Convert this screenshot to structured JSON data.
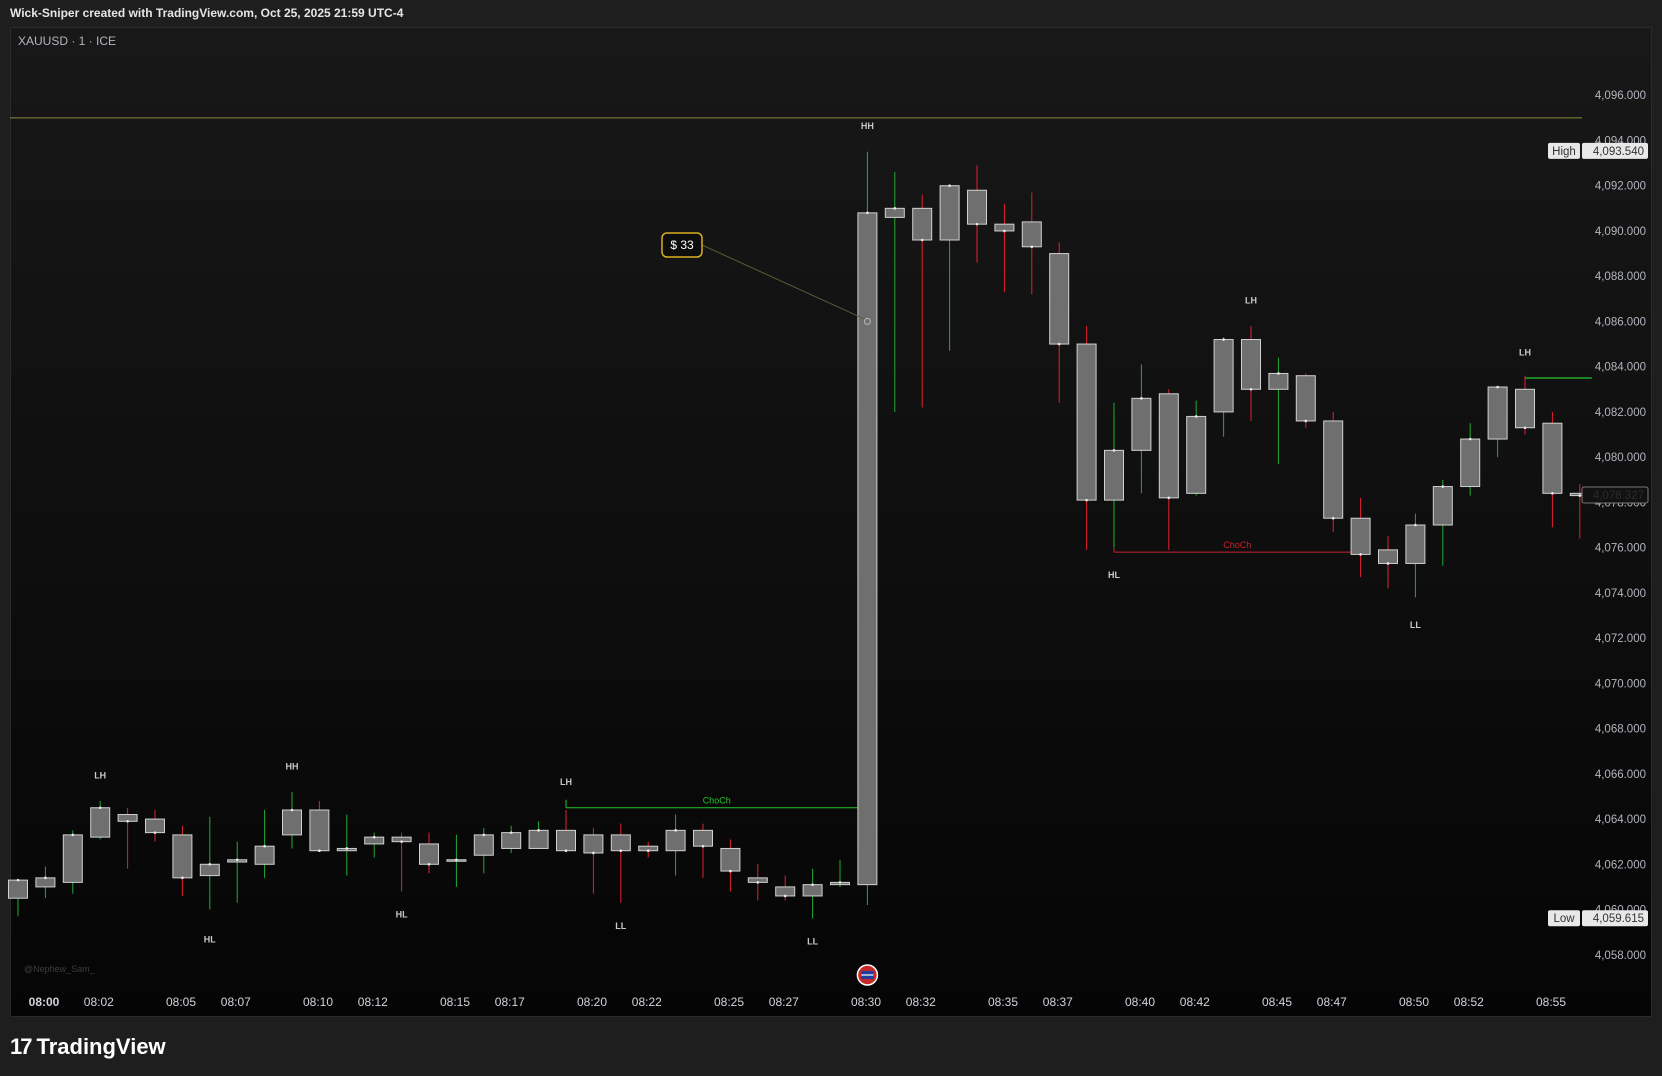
{
  "header": {
    "title": "Wick-Sniper created with TradingView.com, Oct 25, 2025 21:59 UTC-4",
    "symbol": "XAUUSD · 1 · ICE",
    "watermark": "@Nephew_Sam_",
    "brand": "TradingView",
    "brand_logo": "17"
  },
  "colors": {
    "up_wick": "#22ab35",
    "down_wick": "#e0202e",
    "candle_body": "#6f6f6f",
    "candle_border": "#d0d0d0",
    "choch_up": "#24c52b",
    "choch_down": "#c8212d",
    "level_line": "#8a8a3a",
    "callout_border": "#d9b021"
  },
  "chart_data": {
    "type": "candlestick",
    "ylim": [
      4056.0,
      4098.0
    ],
    "yticks": [
      "4,096.000",
      "4,094.000",
      "4,092.000",
      "4,090.000",
      "4,088.000",
      "4,086.000",
      "4,084.000",
      "4,082.000",
      "4,080.000",
      "4,078.000",
      "4,076.000",
      "4,074.000",
      "4,072.000",
      "4,070.000",
      "4,068.000",
      "4,066.000",
      "4,064.000",
      "4,062.000",
      "4,060.000",
      "4,058.000"
    ],
    "ytick_values": [
      4096,
      4094,
      4092,
      4090,
      4088,
      4086,
      4084,
      4082,
      4080,
      4078,
      4076,
      4074,
      4072,
      4070,
      4068,
      4066,
      4064,
      4062,
      4060,
      4058
    ],
    "xticks": [
      {
        "label": "08:00",
        "i": 0,
        "bold": true
      },
      {
        "label": "08:02",
        "i": 2
      },
      {
        "label": "08:05",
        "i": 5
      },
      {
        "label": "08:07",
        "i": 7
      },
      {
        "label": "08:10",
        "i": 10
      },
      {
        "label": "08:12",
        "i": 12
      },
      {
        "label": "08:15",
        "i": 15
      },
      {
        "label": "08:17",
        "i": 17
      },
      {
        "label": "08:20",
        "i": 20
      },
      {
        "label": "08:22",
        "i": 22
      },
      {
        "label": "08:25",
        "i": 25
      },
      {
        "label": "08:27",
        "i": 27
      },
      {
        "label": "08:30",
        "i": 30
      },
      {
        "label": "08:32",
        "i": 32
      },
      {
        "label": "08:35",
        "i": 35
      },
      {
        "label": "08:37",
        "i": 37
      },
      {
        "label": "08:40",
        "i": 40
      },
      {
        "label": "08:42",
        "i": 42
      },
      {
        "label": "08:45",
        "i": 45
      },
      {
        "label": "08:47",
        "i": 47
      },
      {
        "label": "08:50",
        "i": 50
      },
      {
        "label": "08:52",
        "i": 52
      },
      {
        "label": "08:55",
        "i": 55
      }
    ],
    "candles": [
      {
        "t": "08:00",
        "o": 4060.5,
        "h": 4061.2,
        "l": 4059.7,
        "c": 4061.3
      },
      {
        "t": "08:01",
        "o": 4061.0,
        "h": 4061.9,
        "l": 4060.5,
        "c": 4061.4
      },
      {
        "t": "08:02",
        "o": 4061.2,
        "h": 4063.5,
        "l": 4060.7,
        "c": 4063.3
      },
      {
        "t": "08:03",
        "o": 4063.2,
        "h": 4064.8,
        "l": 4063.1,
        "c": 4064.5
      },
      {
        "t": "08:04",
        "o": 4064.2,
        "h": 4064.5,
        "l": 4061.8,
        "c": 4063.9
      },
      {
        "t": "08:05",
        "o": 4064.0,
        "h": 4064.4,
        "l": 4063.0,
        "c": 4063.4
      },
      {
        "t": "08:06",
        "o": 4063.3,
        "h": 4063.7,
        "l": 4060.6,
        "c": 4061.4
      },
      {
        "t": "08:07",
        "o": 4061.5,
        "h": 4064.1,
        "l": 4060.0,
        "c": 4062.0
      },
      {
        "t": "08:08",
        "o": 4062.1,
        "h": 4063.0,
        "l": 4060.3,
        "c": 4062.2
      },
      {
        "t": "08:09",
        "o": 4062.0,
        "h": 4064.4,
        "l": 4061.4,
        "c": 4062.8
      },
      {
        "t": "08:10",
        "o": 4063.3,
        "h": 4065.2,
        "l": 4062.7,
        "c": 4064.4
      },
      {
        "t": "08:11",
        "o": 4064.4,
        "h": 4064.8,
        "l": 4062.6,
        "c": 4062.6
      },
      {
        "t": "08:12",
        "o": 4062.6,
        "h": 4064.2,
        "l": 4061.5,
        "c": 4062.7
      },
      {
        "t": "08:13",
        "o": 4062.9,
        "h": 4063.4,
        "l": 4062.3,
        "c": 4063.2
      },
      {
        "t": "08:14",
        "o": 4063.2,
        "h": 4063.4,
        "l": 4060.8,
        "c": 4063.0
      },
      {
        "t": "08:15",
        "o": 4062.9,
        "h": 4063.4,
        "l": 4061.6,
        "c": 4062.0
      },
      {
        "t": "08:16",
        "o": 4062.2,
        "h": 4063.3,
        "l": 4061.0,
        "c": 4062.2
      },
      {
        "t": "08:17",
        "o": 4062.4,
        "h": 4063.6,
        "l": 4061.6,
        "c": 4063.3
      },
      {
        "t": "08:18",
        "o": 4062.7,
        "h": 4063.7,
        "l": 4062.5,
        "c": 4063.4
      },
      {
        "t": "08:19",
        "o": 4062.7,
        "h": 4063.9,
        "l": 4062.7,
        "c": 4063.5
      },
      {
        "t": "08:20",
        "o": 4063.5,
        "h": 4064.4,
        "l": 4062.6,
        "c": 4062.6
      },
      {
        "t": "08:21",
        "o": 4063.3,
        "h": 4063.6,
        "l": 4060.7,
        "c": 4062.5
      },
      {
        "t": "08:22",
        "o": 4063.3,
        "h": 4063.8,
        "l": 4060.3,
        "c": 4062.6
      },
      {
        "t": "08:23",
        "o": 4062.8,
        "h": 4063.0,
        "l": 4062.3,
        "c": 4062.6
      },
      {
        "t": "08:24",
        "o": 4062.6,
        "h": 4064.2,
        "l": 4061.5,
        "c": 4063.5
      },
      {
        "t": "08:25",
        "o": 4063.5,
        "h": 4063.8,
        "l": 4061.4,
        "c": 4062.8
      },
      {
        "t": "08:26",
        "o": 4062.7,
        "h": 4063.1,
        "l": 4060.8,
        "c": 4061.7
      },
      {
        "t": "08:27",
        "o": 4061.4,
        "h": 4062.0,
        "l": 4060.4,
        "c": 4061.2
      },
      {
        "t": "08:28",
        "o": 4061.0,
        "h": 4061.5,
        "l": 4060.4,
        "c": 4060.6
      },
      {
        "t": "08:29",
        "o": 4060.6,
        "h": 4061.8,
        "l": 4059.6,
        "c": 4061.1
      },
      {
        "t": "08:30",
        "o": 4061.1,
        "h": 4062.2,
        "l": 4061.0,
        "c": 4061.2
      },
      {
        "t": "08:31",
        "o": 4061.1,
        "h": 4093.5,
        "l": 4060.2,
        "c": 4090.8
      },
      {
        "t": "08:32",
        "o": 4090.6,
        "h": 4092.6,
        "l": 4082.0,
        "c": 4091.0
      },
      {
        "t": "08:33",
        "o": 4091.0,
        "h": 4091.6,
        "l": 4082.2,
        "c": 4089.6
      },
      {
        "t": "08:34",
        "o": 4089.6,
        "h": 4092.0,
        "l": 4084.7,
        "c": 4092.0
      },
      {
        "t": "08:35",
        "o": 4091.8,
        "h": 4092.9,
        "l": 4088.6,
        "c": 4090.3
      },
      {
        "t": "08:36",
        "o": 4090.3,
        "h": 4091.2,
        "l": 4087.3,
        "c": 4090.0
      },
      {
        "t": "08:37",
        "o": 4090.4,
        "h": 4091.7,
        "l": 4087.2,
        "c": 4089.3
      },
      {
        "t": "08:38",
        "o": 4089.0,
        "h": 4089.5,
        "l": 4082.4,
        "c": 4085.0
      },
      {
        "t": "08:39",
        "o": 4085.0,
        "h": 4085.8,
        "l": 4075.9,
        "c": 4078.1
      },
      {
        "t": "08:40",
        "o": 4078.1,
        "h": 4082.4,
        "l": 4076.0,
        "c": 4080.3
      },
      {
        "t": "08:41",
        "o": 4080.3,
        "h": 4084.1,
        "l": 4078.4,
        "c": 4082.6
      },
      {
        "t": "08:42",
        "o": 4082.8,
        "h": 4083.0,
        "l": 4075.9,
        "c": 4078.2
      },
      {
        "t": "08:43",
        "o": 4078.4,
        "h": 4082.5,
        "l": 4078.3,
        "c": 4081.8
      },
      {
        "t": "08:44",
        "o": 4082.0,
        "h": 4085.3,
        "l": 4080.9,
        "c": 4085.2
      },
      {
        "t": "08:45",
        "o": 4085.2,
        "h": 4085.8,
        "l": 4081.6,
        "c": 4083.0
      },
      {
        "t": "08:46",
        "o": 4083.0,
        "h": 4084.4,
        "l": 4079.7,
        "c": 4083.7
      },
      {
        "t": "08:47",
        "o": 4083.6,
        "h": 4083.7,
        "l": 4081.3,
        "c": 4081.6
      },
      {
        "t": "08:48",
        "o": 4081.6,
        "h": 4082.0,
        "l": 4076.7,
        "c": 4077.3
      },
      {
        "t": "08:49",
        "o": 4077.3,
        "h": 4078.2,
        "l": 4074.7,
        "c": 4075.7
      },
      {
        "t": "08:50",
        "o": 4075.9,
        "h": 4076.5,
        "l": 4074.2,
        "c": 4075.3
      },
      {
        "t": "08:51",
        "o": 4075.3,
        "h": 4077.5,
        "l": 4073.8,
        "c": 4077.0
      },
      {
        "t": "08:52",
        "o": 4077.0,
        "h": 4079.0,
        "l": 4075.2,
        "c": 4078.7
      },
      {
        "t": "08:53",
        "o": 4078.7,
        "h": 4081.5,
        "l": 4078.3,
        "c": 4080.8
      },
      {
        "t": "08:54",
        "o": 4080.8,
        "h": 4082.1,
        "l": 4080.0,
        "c": 4083.1
      },
      {
        "t": "08:55",
        "o": 4083.0,
        "h": 4083.6,
        "l": 4081.0,
        "c": 4081.3
      },
      {
        "t": "08:56",
        "o": 4081.5,
        "h": 4082.0,
        "l": 4076.9,
        "c": 4078.4
      },
      {
        "t": "08:57",
        "o": 4078.4,
        "h": 4078.8,
        "l": 4076.4,
        "c": 4078.3
      }
    ],
    "swing_labels": [
      {
        "text": "LH",
        "i": 3,
        "price": 4065.8,
        "pos": "above"
      },
      {
        "text": "HL",
        "i": 7,
        "price": 4058.9,
        "pos": "below"
      },
      {
        "text": "HH",
        "i": 10,
        "price": 4066.2,
        "pos": "above"
      },
      {
        "text": "HL",
        "i": 14,
        "price": 4060.0,
        "pos": "below"
      },
      {
        "text": "LH",
        "i": 20,
        "price": 4065.5,
        "pos": "above"
      },
      {
        "text": "LL",
        "i": 22,
        "price": 4059.5,
        "pos": "below"
      },
      {
        "text": "LL",
        "i": 29,
        "price": 4058.8,
        "pos": "below"
      },
      {
        "text": "HH",
        "i": 31,
        "price": 4094.5,
        "pos": "above"
      },
      {
        "text": "HL",
        "i": 40,
        "price": 4075.0,
        "pos": "below"
      },
      {
        "text": "LH",
        "i": 45,
        "price": 4086.8,
        "pos": "above"
      },
      {
        "text": "LL",
        "i": 51,
        "price": 4072.8,
        "pos": "below"
      },
      {
        "text": "LH",
        "i": 55,
        "price": 4084.5,
        "pos": "above"
      }
    ],
    "choch_lines": [
      {
        "label": "ChoCh",
        "i_start": 20,
        "i_end": 31,
        "price": 4064.5,
        "color": "#24c52b"
      },
      {
        "label": "ChoCh",
        "i_start": 40,
        "i_end": 49,
        "price": 4075.8,
        "color": "#c8212d"
      }
    ],
    "level_line": {
      "price": 4095.0
    },
    "green_marker": {
      "i_start": 55,
      "i_end": 57,
      "price": 4083.5
    },
    "callout": {
      "label": "$ 33",
      "anchor_i": 31,
      "anchor_price": 4086.0
    },
    "high_label": {
      "tag": "High",
      "value": "4,093.540",
      "price": 4093.54
    },
    "low_label": {
      "tag": "Low",
      "value": "4,059.615",
      "price": 4059.615
    },
    "last_price": {
      "value": "4,078.327",
      "price": 4078.327
    },
    "event_icon": {
      "i": 31,
      "name": "us-flag-icon"
    }
  }
}
